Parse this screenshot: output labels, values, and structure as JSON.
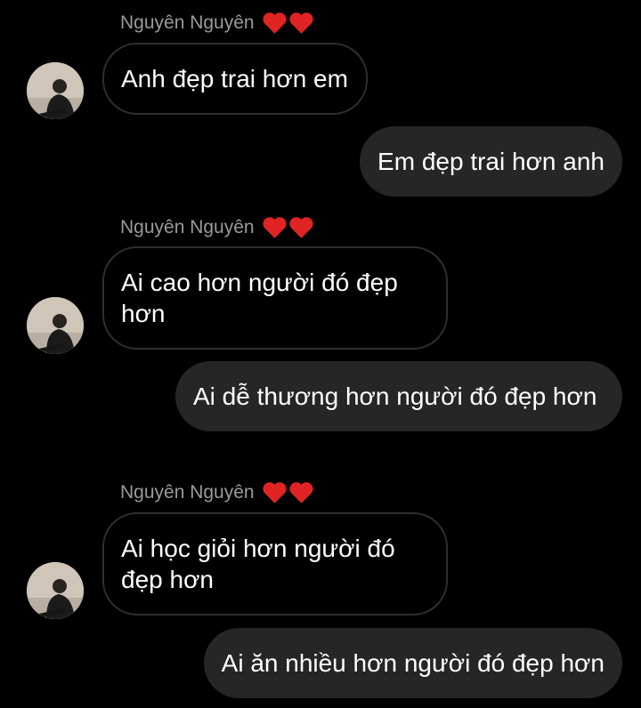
{
  "colors": {
    "background": "#000000",
    "sender_name": "#9a9a9a",
    "outgoing_bubble": "#262626",
    "incoming_bubble_border": "#2f2f2f",
    "heart": "#e02424"
  },
  "contact": {
    "name": "Nguyên Nguyên",
    "name_icons": [
      "heart-emoji",
      "heart-emoji"
    ]
  },
  "messages": [
    {
      "direction": "incoming",
      "text": "Anh đẹp trai hơn em"
    },
    {
      "direction": "outgoing",
      "text": "Em đẹp trai hơn anh"
    },
    {
      "direction": "incoming",
      "text": "Ai cao hơn người đó đẹp hơn"
    },
    {
      "direction": "outgoing",
      "text": "Ai dễ thương hơn người đó đẹp hơn"
    },
    {
      "direction": "incoming",
      "text": "Ai học giỏi hơn người đó đẹp hơn"
    },
    {
      "direction": "outgoing",
      "text": "Ai ăn nhiều hơn người đó đẹp hơn"
    }
  ]
}
